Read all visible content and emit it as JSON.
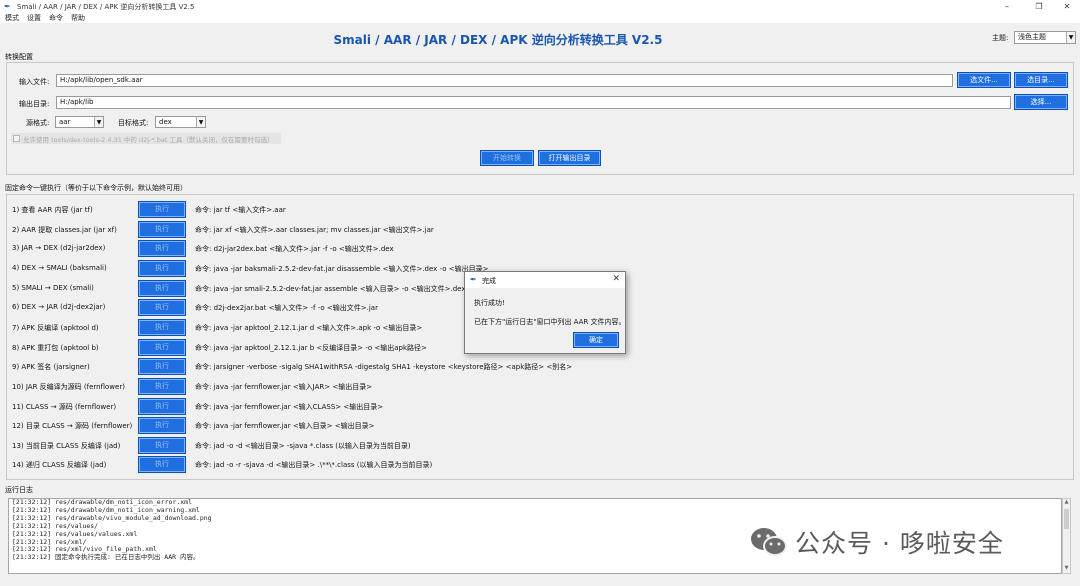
{
  "window": {
    "title": "Smali / AAR / JAR / DEX / APK 逆向分析转换工具 V2.5"
  },
  "menu": [
    "模式",
    "设置",
    "命令",
    "帮助"
  ],
  "header": {
    "title": "Smali / AAR / JAR / DEX / APK 逆向分析转换工具 V2.5",
    "theme_label": "主题:",
    "theme_value": "浅色主题"
  },
  "config": {
    "section_label": "转换配置",
    "input_label": "输入文件:",
    "input_value": "H:/apk/lib/open_sdk.aar",
    "choose_file_btn": "选文件...",
    "choose_dir_btn": "选目录...",
    "output_label": "输出目录:",
    "output_value": "H:/apk/lib",
    "choose_btn": "选择...",
    "source_format_label": "源格式:",
    "source_format_value": "aar",
    "target_format_label": "目标格式:",
    "target_format_value": "dex",
    "option_text": "允许使用 tools/dex-tools-2.4.31 中的 d2j-*.bat 工具（默认关闭，仅在需要时勾选）",
    "start_btn": "开始转换",
    "open_output_btn": "打开输出目录"
  },
  "commands": {
    "section_label": "固定命令一键执行（等价于以下命令示例，默认始终可用）",
    "run_label": "执行",
    "rows": [
      {
        "name": "1) 查看 AAR 内容 (jar tf)",
        "cmd": "命令: jar tf <输入文件>.aar"
      },
      {
        "name": "2) AAR 提取 classes.jar (jar xf)",
        "cmd": "命令: jar xf <输入文件>.aar classes.jar; mv classes.jar <输出文件>.jar"
      },
      {
        "name": "3) JAR → DEX (d2j-jar2dex)",
        "cmd": "命令: d2j-jar2dex.bat <输入文件>.jar -f -o <输出文件>.dex"
      },
      {
        "name": "4) DEX → SMALI (baksmali)",
        "cmd": "命令: java -jar baksmali-2.5.2-dev-fat.jar disassemble <输入文件>.dex -o <输出目录>"
      },
      {
        "name": "5) SMALI → DEX (smali)",
        "cmd": "命令: java -jar smali-2.5.2-dev-fat.jar assemble <输入目录> -o <输出文件>.dex"
      },
      {
        "name": "6) DEX → JAR (d2j-dex2jar)",
        "cmd": "命令: d2j-dex2jar.bat <输入文件> -f -o <输出文件>.jar"
      },
      {
        "name": "7) APK 反编译 (apktool d)",
        "cmd": "命令: java -jar apktool_2.12.1.jar d <输入文件>.apk -o <输出目录>"
      },
      {
        "name": "8) APK 重打包 (apktool b)",
        "cmd": "命令: java -jar apktool_2.12.1.jar b <反编译目录> -o <输出apk路径>"
      },
      {
        "name": "9) APK 签名 (jarsigner)",
        "cmd": "命令: jarsigner -verbose -sigalg SHA1withRSA -digestalg SHA1 -keystore <keystore路径> <apk路径> <别名>"
      },
      {
        "name": "10) JAR 反编译为源码 (fernflower)",
        "cmd": "命令: java -jar fernflower.jar <输入JAR> <输出目录>"
      },
      {
        "name": "11) CLASS → 源码 (fernflower)",
        "cmd": "命令: java -jar fernflower.jar <输入CLASS> <输出目录>"
      },
      {
        "name": "12) 目录 CLASS → 源码 (fernflower)",
        "cmd": "命令: java -jar fernflower.jar <输入目录> <输出目录>"
      },
      {
        "name": "13) 当前目录 CLASS 反编译 (jad)",
        "cmd": "命令: jad -o -d <输出目录> -sjava *.class (以输入目录为当前目录)"
      },
      {
        "name": "14) 递归 CLASS 反编译 (jad)",
        "cmd": "命令: jad -o -r -sjava -d <输出目录> .\\**\\*.class (以输入目录为当前目录)"
      }
    ]
  },
  "log": {
    "section_label": "运行日志",
    "lines": [
      "[21:32:12] res/drawable/dm_noti_icon_error.xml",
      "[21:32:12] res/drawable/dm_noti_icon_warning.xml",
      "[21:32:12] res/drawable/vivo_module_ad_download.png",
      "[21:32:12] res/values/",
      "[21:32:12] res/values/values.xml",
      "[21:32:12] res/xml/",
      "[21:32:12] res/xml/vivo_file_path.xml",
      "[21:32:12] 固定命令执行完成: 已在日志中列出 AAR 内容。"
    ]
  },
  "dialog": {
    "title": "完成",
    "message1": "执行成功!",
    "message2": "已在下方\"运行日志\"窗口中列出 AAR 文件内容。",
    "ok_btn": "确定"
  },
  "watermark": {
    "text": "公众号 · 哆啦安全"
  },
  "colors": {
    "accent": "#1f6fe0",
    "title": "#1a56b0"
  }
}
